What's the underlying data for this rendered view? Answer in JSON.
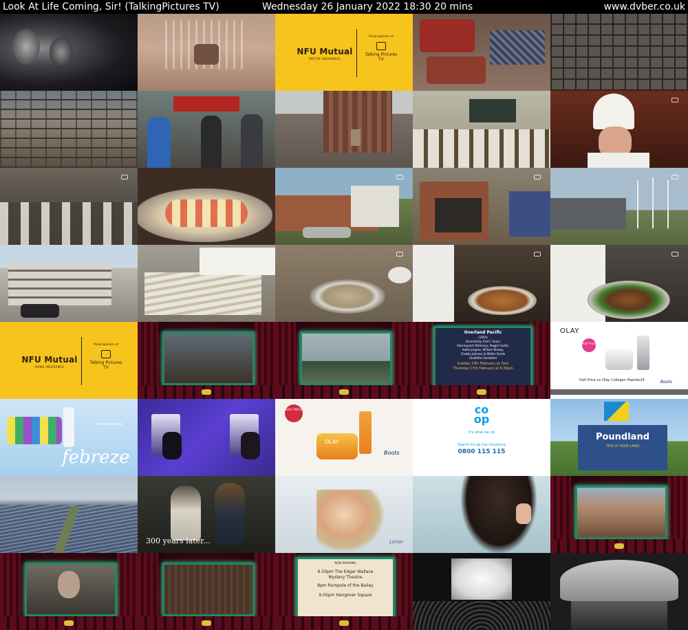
{
  "header": {
    "title": "Look At Life Coming, Sir! (TalkingPictures TV)",
    "when": "Wednesday 26 January 2022  18:30  20 mins",
    "site": "www.dvber.co.uk"
  },
  "colors": {
    "background": "#000000",
    "header_text": "#ffffff",
    "ad_yellow": "#f7c31d"
  },
  "ads": {
    "nfu_motor": {
      "brand": "NFU Mutual",
      "line": "MOTOR INSURANCE",
      "sponsor_note": "Proud sponsors of",
      "channel": "Talking Pictures",
      "channel_tv": "TV"
    },
    "nfu_home": {
      "brand": "NFU Mutual",
      "line": "HOME INSURANCE",
      "sponsor_note": "Proud sponsors of",
      "channel": "Talking Pictures",
      "channel_tv": "TV"
    },
    "olay": {
      "logo": "OLAY",
      "badge": "Half Price",
      "headline": "Half Price on Olay Collagen Peptide24",
      "store": "Boots"
    },
    "febreze": {
      "brand": "febreze",
      "tagline": "breathe happy"
    },
    "olay_boots": {
      "badge": "HALF PRICE",
      "brand": "OLAY",
      "store": "Boots"
    },
    "coop": {
      "logo_top": "co",
      "logo_bottom": "op",
      "tagline": "It's what we do",
      "line": "Search Co-op Car Insurance",
      "phone": "0800 115 115"
    },
    "poundland": {
      "brand": "Poundland",
      "slogan": "THIS IS YOUR LAND"
    },
    "lenor": {
      "brand": "Lenor"
    }
  },
  "film_card": {
    "title": "Overland Pacific",
    "year": "(1954)",
    "director": "Directed by Fred F. Sears",
    "cast_1": "Starring Jock Mahoney, Peggie Castle,",
    "cast_2": "Adele Jergens, William Bishop,",
    "cast_3": "Chubby Johnson & Walter Sande",
    "subtitles": "(Subtitles Available)",
    "showing_1": "Sunday 13th February at 7pm",
    "showing_2": "Thursday 17th February at 6.30pm"
  },
  "now_showing": {
    "heading": "NOW SHOWING",
    "line_1": "6.50pm The Edgar Wallace",
    "line_2": "Mystery Theatre",
    "line_3": "8pm Rumpole of the Bailey",
    "line_4": "9.05pm Hangover Square"
  },
  "captions": {
    "years_later": "300 years later..."
  },
  "frames": [
    "couple-closeup-dark",
    "exhibition-stage-sepia",
    "nfu-motor-ad",
    "luggage",
    "steel-frame-construction",
    "construction-site",
    "crowd-street-bus",
    "london-street",
    "classroom-chefs",
    "chef-hat-portrait",
    "kitchen-chefs",
    "fruit-platter",
    "village-street",
    "garage",
    "flags-building",
    "office-block",
    "pastry-hands",
    "plate-serving",
    "chefs-carving",
    "roast-platter",
    "nfu-home-ad",
    "cinema-rocks",
    "cinema-landscape",
    "cinema-film-card",
    "olay-collagen-ad",
    "febreze-ad",
    "always-discreet-ad",
    "olay-boots-ad",
    "coop-insurance-ad",
    "poundland-ad",
    "solar-field",
    "wizards-scene",
    "laughing-woman",
    "hair-care-ad",
    "cinema-street",
    "cinema-man-portrait",
    "cinema-door",
    "cinema-now-showing",
    "cinema-audience",
    "engraved-globe"
  ]
}
